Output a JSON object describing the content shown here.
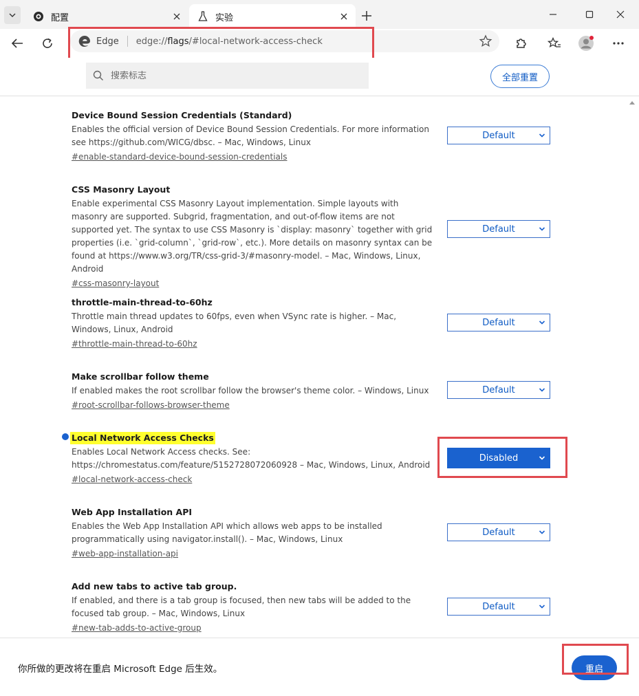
{
  "tabs": [
    {
      "title": "配置",
      "icon": "camera-icon",
      "active": false
    },
    {
      "title": "实验",
      "icon": "flask-icon",
      "active": true
    }
  ],
  "address_bar": {
    "brand": "Edge",
    "url_prefix": "edge://",
    "url_host": "flags",
    "url_rest": "/#local-network-access-check"
  },
  "flags_header": {
    "search_placeholder": "搜索标志",
    "reset_all_label": "全部重置"
  },
  "experiments": [
    {
      "title": "Device Bound Session Credentials (Standard)",
      "description": "Enables the official version of Device Bound Session Credentials. For more information see https://github.com/WICG/dbsc. – Mac, Windows, Linux",
      "link": "#enable-standard-device-bound-session-credentials",
      "value": "Default",
      "modified": false
    },
    {
      "title": "CSS Masonry Layout",
      "description": "Enable experimental CSS Masonry Layout implementation. Simple layouts with masonry are supported. Subgrid, fragmentation, and out-of-flow items are not supported yet. The syntax to use CSS Masonry is `display: masonry` together with grid properties (i.e. `grid-column`, `grid-row`, etc.). More details on masonry syntax can be found at https://www.w3.org/TR/css-grid-3/#masonry-model. – Mac, Windows, Linux, Android",
      "link": "#css-masonry-layout",
      "value": "Default",
      "modified": false
    },
    {
      "title": "throttle-main-thread-to-60hz",
      "description": "Throttle main thread updates to 60fps, even when VSync rate is higher. – Mac, Windows, Linux, Android",
      "link": "#throttle-main-thread-to-60hz",
      "value": "Default",
      "modified": false
    },
    {
      "title": "Make scrollbar follow theme",
      "description": "If enabled makes the root scrollbar follow the browser's theme color. – Windows, Linux",
      "link": "#root-scrollbar-follows-browser-theme",
      "value": "Default",
      "modified": false
    },
    {
      "title": "Local Network Access Checks",
      "description": "Enables Local Network Access checks. See: https://chromestatus.com/feature/5152728072060928 – Mac, Windows, Linux, Android",
      "link": "#local-network-access-check",
      "value": "Disabled",
      "modified": true
    },
    {
      "title": "Web App Installation API",
      "description": "Enables the Web App Installation API which allows web apps to be installed programmatically using navigator.install(). – Mac, Windows, Linux",
      "link": "#web-app-installation-api",
      "value": "Default",
      "modified": false
    },
    {
      "title": "Add new tabs to active tab group.",
      "description": "If enabled, and there is a tab group is focused, then new tabs will be added to the focused tab group. – Mac, Windows, Linux",
      "link": "#new-tab-adds-to-active-group",
      "value": "Default",
      "modified": false
    }
  ],
  "bottom_bar": {
    "message": "你所做的更改将在重启 Microsoft Edge 后生效。",
    "relaunch_label": "重启"
  },
  "colors": {
    "accent": "#1a62cf",
    "highlight": "#ffff2e",
    "annotation_red": "#e0494f"
  }
}
